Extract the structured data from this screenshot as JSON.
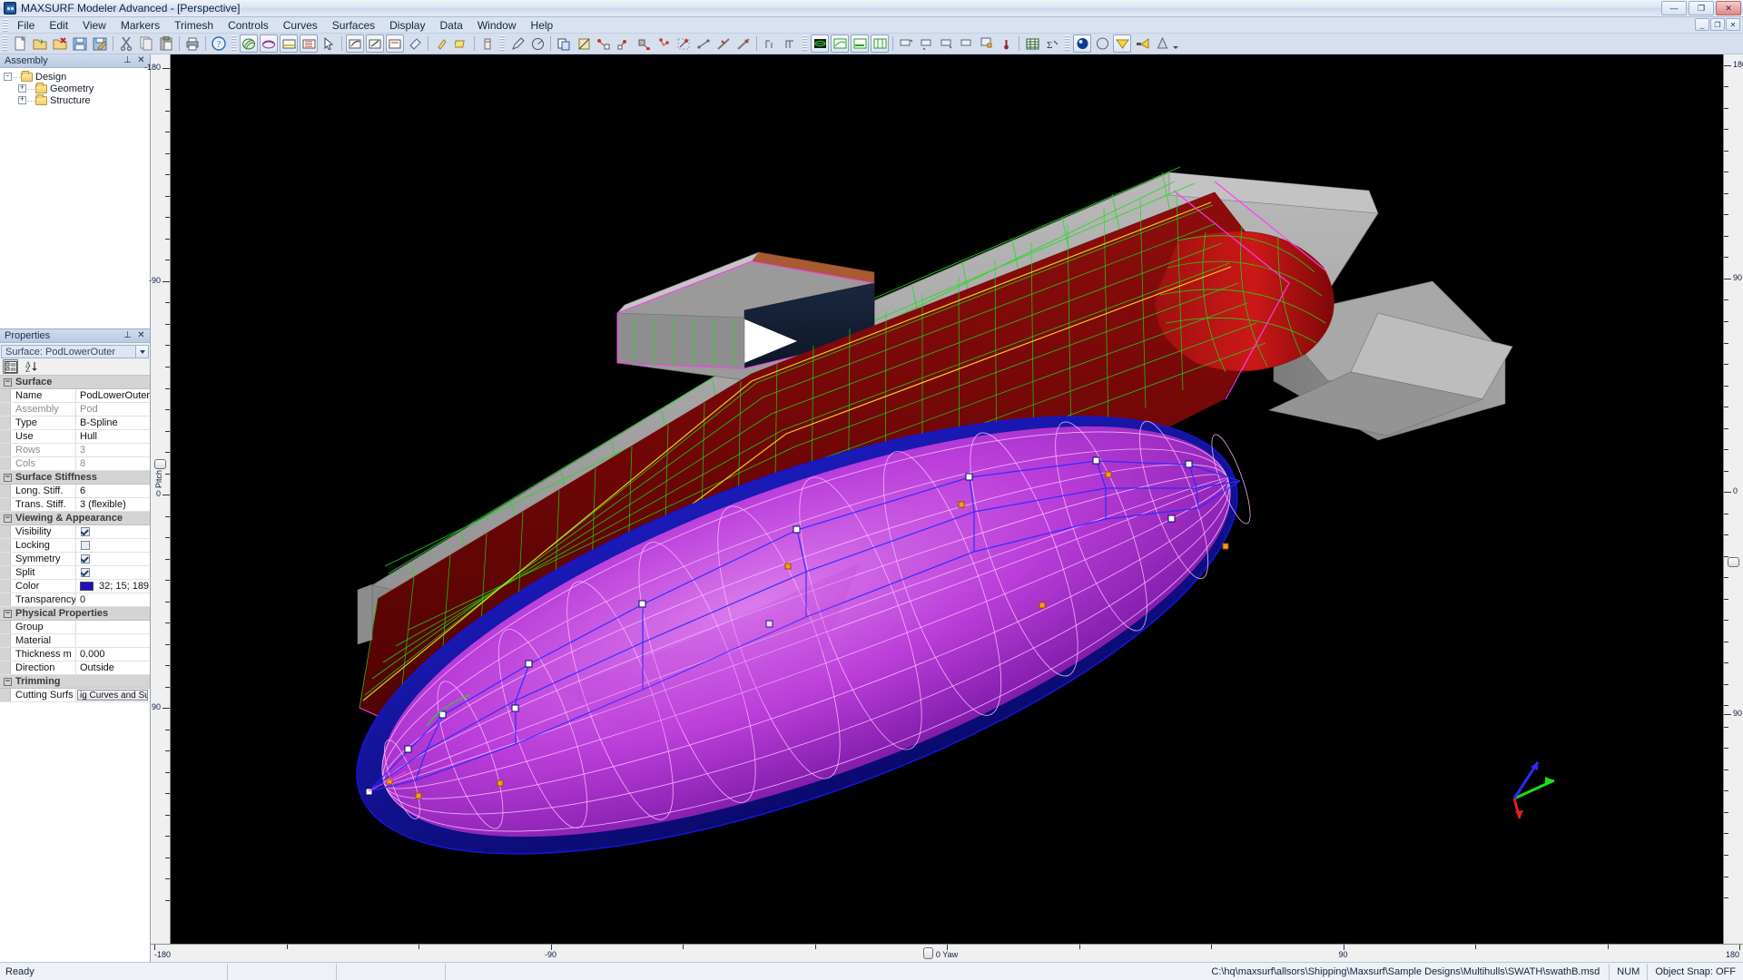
{
  "window": {
    "title": "MAXSURF Modeler Advanced - [Perspective]",
    "app_icon": "maxsurf-app-icon",
    "controls": {
      "minimize": "—",
      "maximize": "❐",
      "close": "✕"
    },
    "mdi_controls": {
      "minimize": "_",
      "restore": "❐",
      "close": "✕"
    }
  },
  "menubar": {
    "items": [
      "File",
      "Edit",
      "View",
      "Markers",
      "Trimesh",
      "Controls",
      "Curves",
      "Surfaces",
      "Display",
      "Data",
      "Window",
      "Help"
    ]
  },
  "toolbar": {
    "groups": [
      {
        "name": "file",
        "buttons": [
          "new-icon",
          "open-icon",
          "close-file-icon",
          "save-icon",
          "save-as-icon",
          "cut-icon",
          "copy-icon",
          "paste-icon",
          "print-icon",
          "help-icon"
        ]
      },
      {
        "name": "display",
        "buttons": [
          "surfaces-icon",
          "contours-icon",
          "waterlines-icon",
          "sections-icon",
          "select-icon",
          "net-icon",
          "edges-icon",
          "grid-icon",
          "render-icon",
          "light-icon",
          "shade-icon",
          "trimesh-icon",
          "pen-icon"
        ]
      },
      {
        "name": "controls",
        "buttons": [
          "control-point-icon",
          "add-point-icon",
          "move-point-icon",
          "delete-point-icon",
          "bind-point-icon",
          "compact-icon",
          "split-icon",
          "join-icon",
          "column-icon",
          "row-icon"
        ]
      },
      {
        "name": "view",
        "buttons": [
          "perspective-view-icon",
          "profile-view-icon",
          "plan-view-icon",
          "body-plan-view-icon",
          "zoom-icon",
          "pan-icon",
          "rotate-icon",
          "home-view-icon",
          "markers-icon",
          "anchor-icon",
          "table-icon",
          "formula-icon"
        ]
      },
      {
        "name": "render",
        "buttons": [
          "render-sphere-icon",
          "wireframe-icon",
          "shade-mode-icon",
          "spotlight-icon",
          "material-icon"
        ]
      }
    ]
  },
  "assembly": {
    "title": "Assembly",
    "pin_icon": "pin-icon",
    "close_icon": "close-icon",
    "tree": [
      {
        "label": "Design",
        "state": "-",
        "level": 1
      },
      {
        "label": "Geometry",
        "state": "+",
        "level": 2
      },
      {
        "label": "Structure",
        "state": "+",
        "level": 2
      }
    ]
  },
  "properties": {
    "title": "Properties",
    "pin_icon": "pin-icon",
    "close_icon": "close-icon",
    "object_selector": "Surface: PodLowerOuter",
    "toolbar_buttons": [
      "categorized-icon",
      "alphabetical-sort-icon"
    ],
    "groups": [
      {
        "name": "Surface",
        "rows": [
          {
            "name": "Name",
            "value": "PodLowerOuter",
            "type": "text",
            "dim": false
          },
          {
            "name": "Assembly",
            "value": "Pod",
            "type": "text",
            "dim": true
          },
          {
            "name": "Type",
            "value": "B-Spline",
            "type": "text",
            "dim": false
          },
          {
            "name": "Use",
            "value": "Hull",
            "type": "text",
            "dim": false
          },
          {
            "name": "Rows",
            "value": "3",
            "type": "text",
            "dim": true
          },
          {
            "name": "Cols",
            "value": "8",
            "type": "text",
            "dim": true
          }
        ]
      },
      {
        "name": "Surface Stiffness",
        "rows": [
          {
            "name": "Long. Stiff.",
            "value": "6",
            "type": "text",
            "dim": false
          },
          {
            "name": "Trans. Stiff.",
            "value": "3 (flexible)",
            "type": "text",
            "dim": false
          }
        ]
      },
      {
        "name": "Viewing & Appearance",
        "rows": [
          {
            "name": "Visibility",
            "value": "",
            "type": "checkbox",
            "checked": true,
            "dim": false
          },
          {
            "name": "Locking",
            "value": "",
            "type": "checkbox",
            "checked": false,
            "dim": false
          },
          {
            "name": "Symmetry",
            "value": "",
            "type": "checkbox",
            "checked": true,
            "dim": false
          },
          {
            "name": "Split",
            "value": "",
            "type": "checkbox",
            "checked": true,
            "dim": false
          },
          {
            "name": "Color",
            "value": "32; 15; 189",
            "type": "color",
            "swatch": "#200fbd",
            "dim": false
          },
          {
            "name": "Transparency %",
            "value": "0",
            "type": "text",
            "dim": false
          }
        ]
      },
      {
        "name": "Physical Properties",
        "rows": [
          {
            "name": "Group",
            "value": "",
            "type": "text",
            "dim": false
          },
          {
            "name": "Material",
            "value": "",
            "type": "text",
            "dim": false
          },
          {
            "name": "Thickness m",
            "value": "0.000",
            "type": "text",
            "dim": false
          },
          {
            "name": "Direction",
            "value": "Outside",
            "type": "text",
            "dim": false
          }
        ]
      },
      {
        "name": "Trimming",
        "rows": [
          {
            "name": "Cutting Surfs",
            "value": "ig Curves and Surfs",
            "type": "button",
            "dim": false
          }
        ]
      }
    ]
  },
  "viewport": {
    "name": "Perspective",
    "background": "#000000",
    "vertical_ruler": {
      "label": "Pitch",
      "ticks": [
        "-180",
        "-90",
        "0",
        "90"
      ]
    },
    "horizontal_ruler": {
      "label": "Yaw",
      "ticks": [
        "-180",
        "-90",
        "0",
        "90",
        "180"
      ]
    },
    "right_ruler": {
      "ticks": [
        "180",
        "90",
        "0",
        "90"
      ]
    },
    "axis_gizmo": "axis-gizmo-icon"
  },
  "statusbar": {
    "ready": "Ready",
    "file_path": "C:\\hq\\maxsurf\\allsors\\Shipping\\Maxsurf\\Sample Designs\\Multihulls\\SWATH\\swathB.msd",
    "num_indicator": "NUM",
    "object_snap": "Object Snap: OFF"
  }
}
